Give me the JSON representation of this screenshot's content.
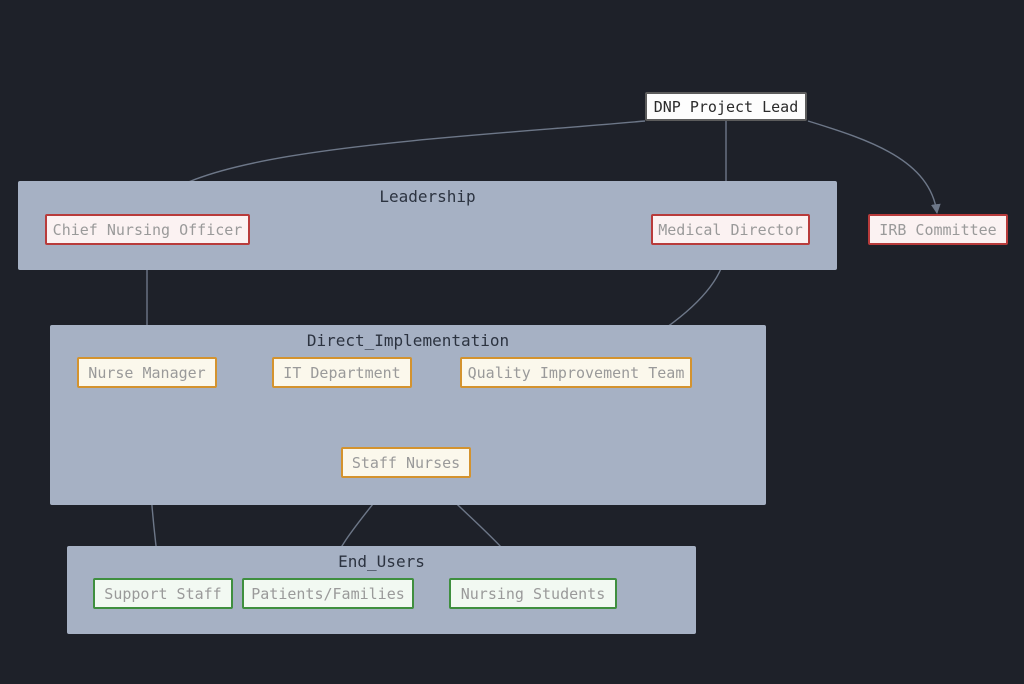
{
  "nodes": {
    "lead": {
      "label": "DNP Project Lead"
    },
    "cno": {
      "label": "Chief Nursing Officer"
    },
    "medDir": {
      "label": "Medical Director"
    },
    "irb": {
      "label": "IRB Committee"
    },
    "nurseMgr": {
      "label": "Nurse Manager"
    },
    "itDept": {
      "label": "IT Department"
    },
    "qiTeam": {
      "label": "Quality Improvement Team"
    },
    "staffN": {
      "label": "Staff Nurses"
    },
    "support": {
      "label": "Support Staff"
    },
    "patients": {
      "label": "Patients/Families"
    },
    "students": {
      "label": "Nursing Students"
    }
  },
  "groups": {
    "leadership": {
      "label": "Leadership"
    },
    "directImpl": {
      "label": "Direct_Implementation"
    },
    "endUsers": {
      "label": "End_Users"
    }
  },
  "edges": [
    {
      "from": "lead",
      "to": "cno"
    },
    {
      "from": "lead",
      "to": "medDir"
    },
    {
      "from": "lead",
      "to": "irb"
    },
    {
      "from": "cno",
      "to": "nurseMgr"
    },
    {
      "from": "medDir",
      "to": "staffN"
    },
    {
      "from": "nurseMgr",
      "to": "staffN"
    },
    {
      "from": "itDept",
      "to": "staffN"
    },
    {
      "from": "qiTeam",
      "to": "staffN"
    },
    {
      "from": "nurseMgr",
      "to": "support"
    },
    {
      "from": "staffN",
      "to": "patients"
    },
    {
      "from": "staffN",
      "to": "students"
    }
  ]
}
